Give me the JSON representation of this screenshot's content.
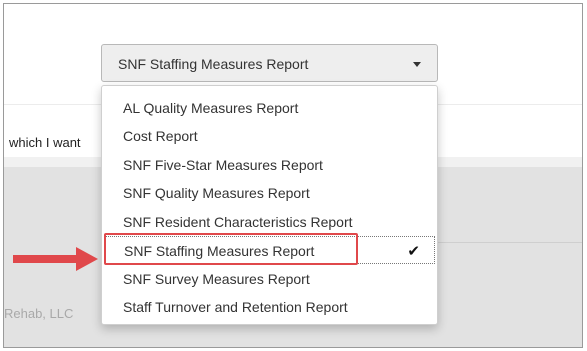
{
  "select": {
    "value": "SNF Staffing Measures Report"
  },
  "dropdown": {
    "options": [
      "AL Quality Measures Report",
      "Cost Report",
      "SNF Five-Star Measures Report",
      "SNF Quality Measures Report",
      "SNF Resident Characteristics Report",
      "SNF Staffing Measures Report",
      "SNF Survey Measures Report",
      "Staff Turnover and Retention Report"
    ],
    "selected_index": 5,
    "check_glyph": "✔"
  },
  "background": {
    "partial_text": "which I want",
    "company_text": "Rehab, LLC"
  },
  "colors": {
    "annotation_red": "#e0484b",
    "select_bg": "#eeeeee",
    "panel_gray": "#e2e2e2"
  }
}
